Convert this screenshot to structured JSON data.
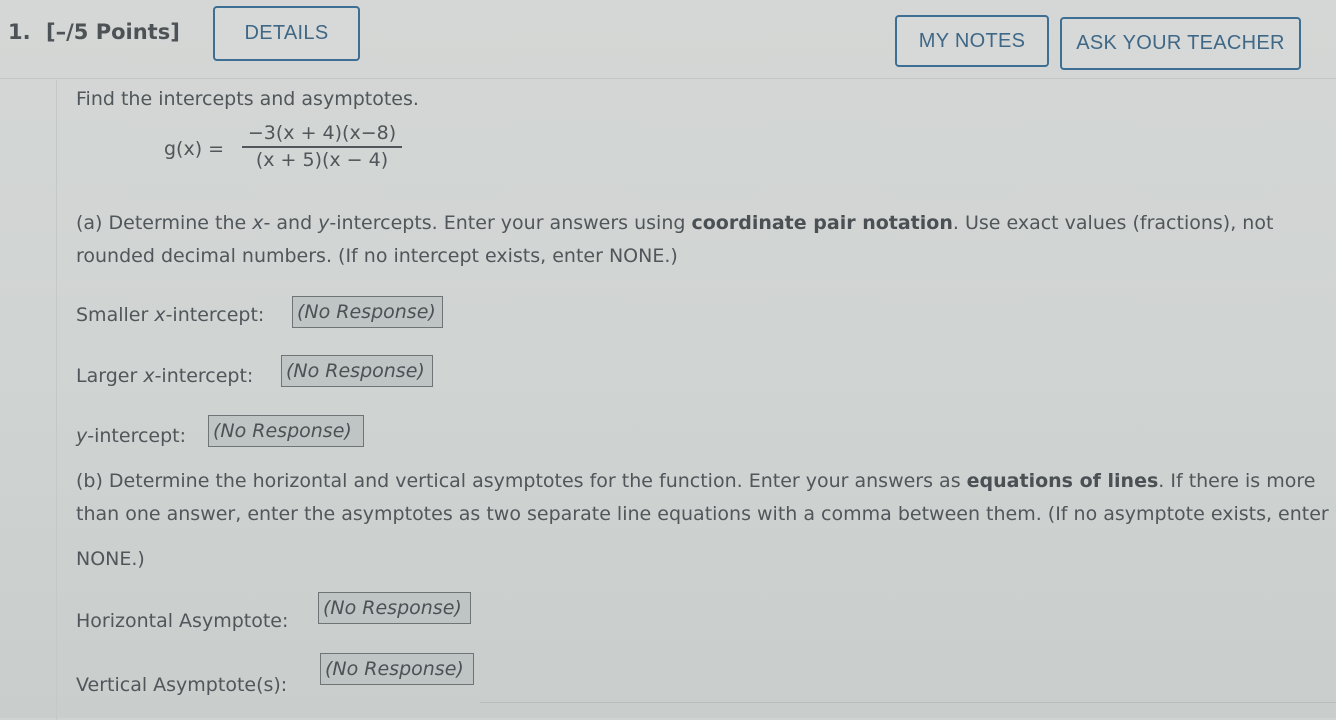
{
  "question": {
    "number": "1.",
    "points": "[–/5 Points]",
    "buttons": {
      "details": "DETAILS",
      "my_notes": "MY NOTES",
      "ask_teacher": "ASK YOUR TEACHER"
    }
  },
  "prompt": "Find the intercepts and asymptotes.",
  "formula": {
    "lhs": "g(x) =",
    "numerator": "−3(x + 4)(x−8)",
    "denominator": "(x + 5)(x − 4)"
  },
  "part_a": {
    "line1_pre": "(a) Determine the ",
    "x_var": "x",
    "line1_mid": "- and ",
    "y_var": "y",
    "line1_post": "-intercepts. Enter your answers using ",
    "line1_bold": "coordinate pair notation",
    "line1_end": ". Use exact values (fractions), not",
    "line2": "rounded decimal numbers. (If no intercept exists, enter NONE.)",
    "fields": [
      {
        "label_pre": "Smaller ",
        "label_var": "x",
        "label_post": "-intercept:",
        "value": "(No Response)"
      },
      {
        "label_pre": "Larger ",
        "label_var": "x",
        "label_post": "-intercept:",
        "value": "(No Response)"
      },
      {
        "label_pre": "",
        "label_var": "y",
        "label_post": "-intercept:",
        "value": "(No Response)"
      }
    ]
  },
  "part_b": {
    "line1_pre": "(b) Determine the horizontal and vertical asymptotes for the function. Enter your answers as ",
    "line1_bold": "equations of lines",
    "line1_end": ". If there is more",
    "line2": "than one answer, enter the asymptotes as two separate line equations with a comma between them. (If no asymptote exists, enter",
    "line3": "NONE.)",
    "fields": [
      {
        "label": "Horizontal Asymptote:",
        "value": "(No Response)"
      },
      {
        "label": "Vertical Asymptote(s):",
        "value": "(No Response)"
      }
    ]
  },
  "colors": {
    "button_border": "#3d6f94",
    "button_text": "#3f6786",
    "response_bg": "#bfc4c5"
  }
}
